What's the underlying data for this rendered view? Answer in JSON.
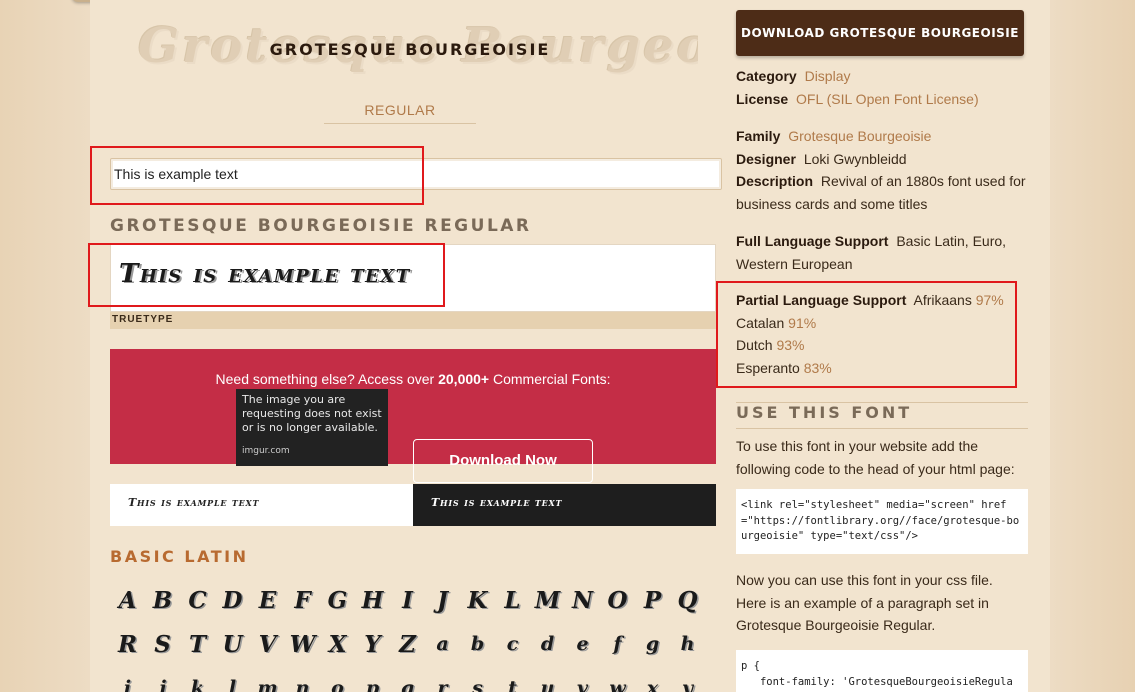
{
  "font": {
    "ghost_banner": "Grotesque Bourgeoisie",
    "title": "GROTESQUE BOURGEOISIE",
    "style_tab": "REGULAR",
    "sample_text": "This is example text",
    "variant_heading": "GROTESQUE BOURGEOISIE REGULAR",
    "preview_text": "This is example text",
    "format_label": "TRUETYPE"
  },
  "promo": {
    "text_before": "Need something else? Access over ",
    "text_bold": "20,000+",
    "text_after": " Commercial Fonts:",
    "button_label": "Download Now",
    "imgur_message": "The image you are requesting does not exist or is no longer available.",
    "imgur_brand": "imgur.com"
  },
  "strips": {
    "light_text": "This is example text",
    "dark_text": "This is example text"
  },
  "basic_latin": {
    "heading": "BASIC LATIN",
    "rows": [
      [
        "A",
        "B",
        "C",
        "D",
        "E",
        "F",
        "G",
        "H",
        "I",
        "J",
        "K",
        "L",
        "M",
        "N",
        "O",
        "P",
        "Q"
      ],
      [
        "R",
        "S",
        "T",
        "U",
        "V",
        "W",
        "X",
        "Y",
        "Z",
        "a",
        "b",
        "c",
        "d",
        "e",
        "f",
        "g",
        "h"
      ],
      [
        "i",
        "j",
        "k",
        "l",
        "m",
        "n",
        "o",
        "p",
        "q",
        "r",
        "s",
        "t",
        "u",
        "v",
        "w",
        "x",
        "y"
      ]
    ]
  },
  "sidebar": {
    "download_label": "DOWNLOAD GROTESQUE BOURGEOISIE",
    "category_key": "Category",
    "category_value": "Display",
    "license_key": "License",
    "license_value": "OFL (SIL Open Font License)",
    "family_key": "Family",
    "family_value": "Grotesque Bourgeoisie",
    "designer_key": "Designer",
    "designer_value": "Loki Gwynbleidd",
    "description_key": "Description",
    "description_value": "Revival of an 1880s font used for business cards and some titles",
    "full_support_key": "Full Language Support",
    "full_support_value": "Basic Latin, Euro, Western European",
    "partial_support_key": "Partial Language Support",
    "partial_languages": [
      {
        "name": "Afrikaans",
        "pct": "97%"
      },
      {
        "name": "Catalan",
        "pct": "91%"
      },
      {
        "name": "Dutch",
        "pct": "93%"
      },
      {
        "name": "Esperanto",
        "pct": "83%"
      }
    ],
    "use_heading": "USE THIS FONT",
    "use_intro": "To use this font in your website add the following code to the head of your html page:",
    "link_code": "<link rel=\"stylesheet\" media=\"screen\" href=\"https://fontlibrary.org//face/grotesque-bourgeoisie\" type=\"text/css\"/>",
    "css_intro": "Now you can use this font in your css file. Here is an example of a paragraph set in Grotesque Bourgeoisie Regular.",
    "css_code": "p {\n   font-family: 'GrotesqueBourgeoisieRegular';\n   font-weight: normal;"
  },
  "colors": {
    "background": "#ead8bf",
    "panel": "#f2e4cf",
    "accent_brown": "#4d2c17",
    "link": "#b07a4a",
    "promo_red": "#c42d46",
    "highlight_red": "#e0191c"
  }
}
